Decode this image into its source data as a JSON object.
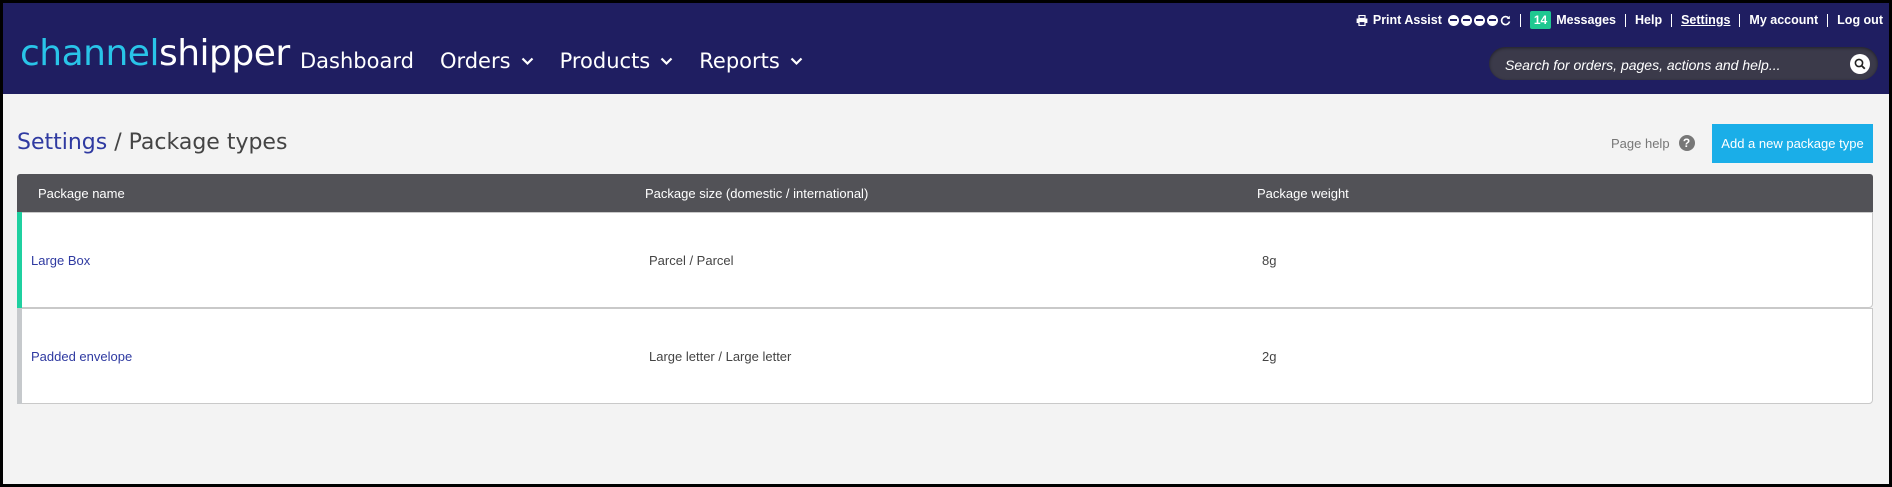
{
  "logo": {
    "part1": "channel",
    "part2": "shipper"
  },
  "nav": [
    {
      "label": "Dashboard",
      "dropdown": false
    },
    {
      "label": "Orders",
      "dropdown": true
    },
    {
      "label": "Products",
      "dropdown": true
    },
    {
      "label": "Reports",
      "dropdown": true
    }
  ],
  "utility": {
    "print_assist": "Print Assist",
    "message_count": "14",
    "messages": "Messages",
    "help": "Help",
    "settings": "Settings",
    "my_account": "My account",
    "log_out": "Log out"
  },
  "search": {
    "placeholder": "Search for orders, pages, actions and help..."
  },
  "page": {
    "breadcrumb_parent": "Settings",
    "separator": " / ",
    "title": "Package types",
    "page_help": "Page help",
    "help_symbol": "?",
    "add_button": "Add a new package type"
  },
  "table": {
    "columns": [
      "Package name",
      "Package size (domestic / international)",
      "Package weight"
    ],
    "rows": [
      {
        "name": "Large Box",
        "size": "Parcel / Parcel",
        "weight": "8g",
        "accent": "#1fd0a0"
      },
      {
        "name": "Padded envelope",
        "size": "Large letter / Large letter",
        "weight": "2g",
        "accent": "#c6c9cc"
      }
    ]
  },
  "colors": {
    "header_bg": "#1f1e61",
    "accent_blue": "#1aaee8",
    "logo_cyan": "#29c4e8",
    "badge_green": "#1fc891"
  }
}
